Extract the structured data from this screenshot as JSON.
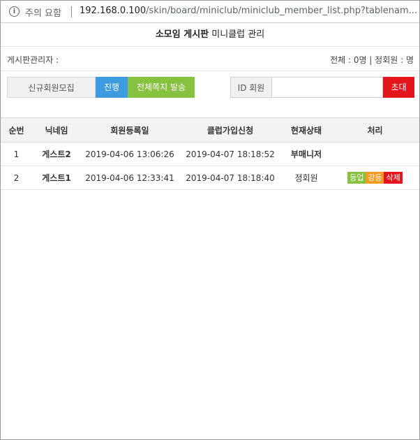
{
  "browser": {
    "security_label": "주의 요함",
    "url_host": "192.168.0.100",
    "url_path": "/skin/board/miniclub/miniclub_member_list.php?tablenam..."
  },
  "page": {
    "title_bold": "소모임 게시판",
    "title_rest": " 미니클럽 관리"
  },
  "info": {
    "admin_label": "게시판관리자 :",
    "summary": "전체 : 0명 | 정회원 : 명"
  },
  "toolbar": {
    "recruit_label": "신규회원모집",
    "proceed_label": "진행",
    "send_all_label": "전체쪽지 발송",
    "id_label": "ID 회원",
    "id_value": "",
    "invite_label": "초대"
  },
  "table": {
    "headers": [
      "순번",
      "닉네임",
      "회원등록일",
      "클럽가입신청",
      "현재상태",
      "처리"
    ],
    "rows": [
      {
        "no": "1",
        "nick": "게스트2",
        "reg": "2019-04-06 13:06:26",
        "join": "2019-04-07 18:18:52",
        "status": "부매니저",
        "actions": []
      },
      {
        "no": "2",
        "nick": "게스트1",
        "reg": "2019-04-06 12:33:41",
        "join": "2019-04-07 18:18:40",
        "status": "정회원",
        "actions": [
          "등업",
          "강등",
          "삭제"
        ]
      }
    ]
  },
  "colors": {
    "proceed": "#3e9be0",
    "send_all": "#86c240",
    "invite": "#e4161d",
    "status_manager": "#7cb82f",
    "status_regular": "#2a6fc9",
    "promote": "#86c240",
    "demote": "#f59a23",
    "delete": "#e4161d"
  }
}
